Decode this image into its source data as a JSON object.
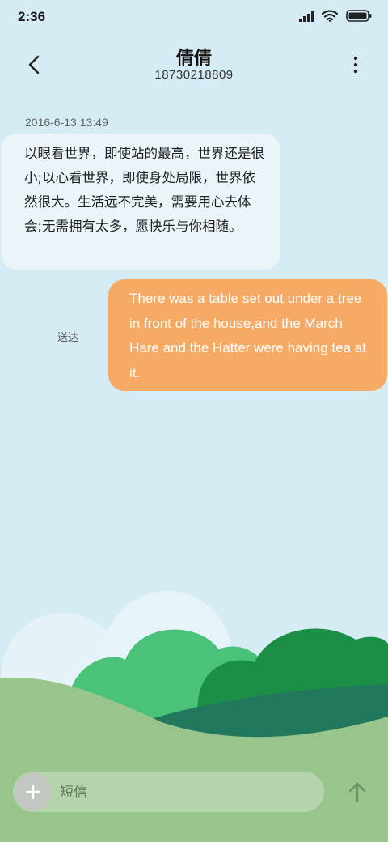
{
  "status_bar": {
    "time": "2:36",
    "icons": [
      "signal-icon",
      "wifi-icon",
      "battery-icon"
    ]
  },
  "header": {
    "title": "倩倩",
    "phone": "18730218809"
  },
  "conversation": {
    "timestamp": "2016-6-13 13:49",
    "received_message": "以眼看世界，即使站的最高，世界还是很小;以心看世界，即使身处局限，世界依然很大。生活远不完美，需要用心去体会;无需拥有太多，愿快乐与你相随。",
    "sent_message": "There was a table set out under a tree in front of the house,and the March Hare and the Hatter were having tea at it.",
    "sent_status": "送达"
  },
  "composer": {
    "placeholder": "短信"
  },
  "colors": {
    "background": "#d6ecf4",
    "incoming_bubble": "#eaf4f9",
    "outgoing_bubble": "#f7aa64",
    "hill": "#98c58b",
    "forest_dark": "#1c8f46",
    "forest_light": "#4bc27a"
  }
}
